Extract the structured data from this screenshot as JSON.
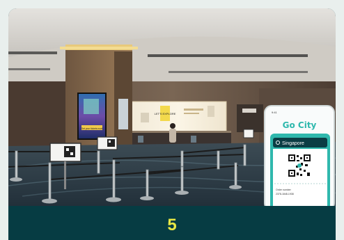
{
  "caption": {
    "number": "5"
  },
  "photo": {
    "phone": {
      "brand": "Go City",
      "location_label": "Singapore",
      "status_time": "9:41",
      "ticket_label": "Order number",
      "ticket_number": "2378-1848-1938"
    },
    "screen_sign": "LET'S EXPLORE",
    "kiosk_sign": "Get your tickets now!"
  },
  "colors": {
    "caption_bg": "#063c43",
    "caption_text": "#e8e845",
    "brand_teal": "#2fb8ad"
  }
}
